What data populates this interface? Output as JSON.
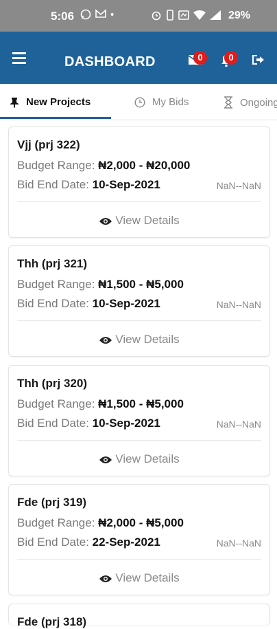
{
  "status_bar": {
    "time": "5:06",
    "battery": "29%"
  },
  "header": {
    "title": "DASHBOARD",
    "messages_badge": "0",
    "notifications_badge": "0"
  },
  "tabs": [
    {
      "label": "New Projects",
      "icon": "pin-icon",
      "active": true
    },
    {
      "label": "My Bids",
      "icon": "clock-icon",
      "active": false
    },
    {
      "label": "Ongoing",
      "icon": "hourglass-icon",
      "active": false
    }
  ],
  "labels": {
    "budget_range": "Budget Range:",
    "bid_end_date": "Bid End Date:",
    "view_details": "View Details"
  },
  "projects": [
    {
      "title": "Vjj (prj 322)",
      "budget": "₦2,000 - ₦20,000",
      "end_date": "10-Sep-2021",
      "countdown": "NaN--NaN"
    },
    {
      "title": "Thh (prj 321)",
      "budget": "₦1,500 - ₦5,000",
      "end_date": "10-Sep-2021",
      "countdown": "NaN--NaN"
    },
    {
      "title": "Thh (prj 320)",
      "budget": "₦1,500 - ₦5,000",
      "end_date": "10-Sep-2021",
      "countdown": "NaN--NaN"
    },
    {
      "title": "Fde (prj 319)",
      "budget": "₦2,000 - ₦5,000",
      "end_date": "22-Sep-2021",
      "countdown": "NaN--NaN"
    },
    {
      "title": "Fde (prj 318)",
      "budget": "",
      "end_date": "",
      "countdown": ""
    }
  ],
  "colors": {
    "primary": "#1e6299",
    "badge": "#e21b1b",
    "status_bar": "#8a8a8a"
  }
}
